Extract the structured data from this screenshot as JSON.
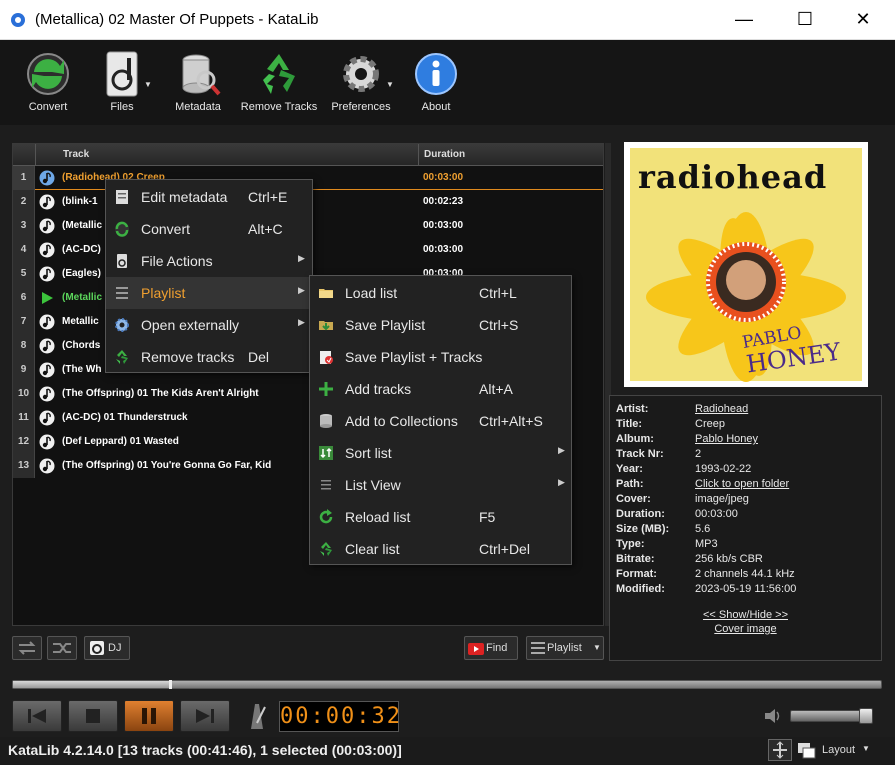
{
  "window": {
    "title": "(Metallica) 02 Master Of Puppets - KataLib"
  },
  "toolbar": {
    "convert": "Convert",
    "files": "Files",
    "metadata": "Metadata",
    "remove_tracks": "Remove Tracks",
    "preferences": "Preferences",
    "about": "About"
  },
  "tracklist": {
    "col_track": "Track",
    "col_duration": "Duration",
    "rows": [
      {
        "n": "1",
        "name": "(Radiohead) 02 Creep",
        "dur": "00:03:00"
      },
      {
        "n": "2",
        "name": "(blink-1",
        "dur": "00:02:23"
      },
      {
        "n": "3",
        "name": "(Metallic",
        "dur": "00:03:00"
      },
      {
        "n": "4",
        "name": "(AC-DC)",
        "dur": "00:03:00"
      },
      {
        "n": "5",
        "name": "(Eagles)",
        "dur": "00:03:00"
      },
      {
        "n": "6",
        "name": "(Metallic",
        "dur": ""
      },
      {
        "n": "7",
        "name": "Metallic",
        "dur": ""
      },
      {
        "n": "8",
        "name": "(Chords",
        "dur": ""
      },
      {
        "n": "9",
        "name": "(The Wh",
        "dur": ""
      },
      {
        "n": "10",
        "name": "(The Offspring) 01 The Kids Aren't Alright",
        "dur": ""
      },
      {
        "n": "11",
        "name": "(AC-DC) 01 Thunderstruck",
        "dur": ""
      },
      {
        "n": "12",
        "name": "(Def Leppard) 01 Wasted",
        "dur": ""
      },
      {
        "n": "13",
        "name": "(The Offspring) 01 You're Gonna Go Far, Kid",
        "dur": ""
      }
    ]
  },
  "context_menu": {
    "items": [
      {
        "label": "Edit metadata",
        "shortcut": "Ctrl+E"
      },
      {
        "label": "Convert",
        "shortcut": "Alt+C"
      },
      {
        "label": "File Actions",
        "shortcut": ""
      },
      {
        "label": "Playlist",
        "shortcut": ""
      },
      {
        "label": "Open externally",
        "shortcut": ""
      },
      {
        "label": "Remove tracks",
        "shortcut": "Del"
      }
    ]
  },
  "playlist_menu": {
    "items": [
      {
        "label": "Load list",
        "shortcut": "Ctrl+L"
      },
      {
        "label": "Save Playlist",
        "shortcut": "Ctrl+S"
      },
      {
        "label": "Save Playlist + Tracks",
        "shortcut": ""
      },
      {
        "label": "Add tracks",
        "shortcut": "Alt+A"
      },
      {
        "label": "Add to Collections",
        "shortcut": "Ctrl+Alt+S"
      },
      {
        "label": "Sort list",
        "shortcut": ""
      },
      {
        "label": "List View",
        "shortcut": ""
      },
      {
        "label": "Reload list",
        "shortcut": "F5"
      },
      {
        "label": "Clear list",
        "shortcut": "Ctrl+Del"
      }
    ]
  },
  "cover": {
    "band": "radiohead",
    "album_line1": "PABLO",
    "album_line2": "HONEY"
  },
  "info": {
    "artist_k": "Artist:",
    "artist_v": "Radiohead",
    "title_k": "Title:",
    "title_v": "Creep",
    "album_k": "Album:",
    "album_v": "Pablo Honey",
    "tracknr_k": "Track Nr:",
    "tracknr_v": "2",
    "year_k": "Year:",
    "year_v": "1993-02-22",
    "path_k": "Path:",
    "path_v": "Click to open folder",
    "cover_k": "Cover:",
    "cover_v": "image/jpeg",
    "duration_k": "Duration:",
    "duration_v": "00:03:00",
    "size_k": "Size (MB):",
    "size_v": "5.6",
    "type_k": "Type:",
    "type_v": "MP3",
    "bitrate_k": "Bitrate:",
    "bitrate_v": "256 kb/s CBR",
    "format_k": "Format:",
    "format_v": "2 channels 44.1 kHz",
    "modified_k": "Modified:",
    "modified_v": "2023-05-19 11:56:00",
    "showhide": "<< Show/Hide >>",
    "cover_image": "Cover image"
  },
  "controls": {
    "dj": "DJ",
    "find": "Find",
    "playlist": "Playlist",
    "timer": "00:00:32",
    "layout": "Layout",
    "seek_fraction": 0.18
  },
  "status": {
    "text": "KataLib 4.2.14.0   [13 tracks (00:41:46), 1 selected (00:03:00)]"
  }
}
